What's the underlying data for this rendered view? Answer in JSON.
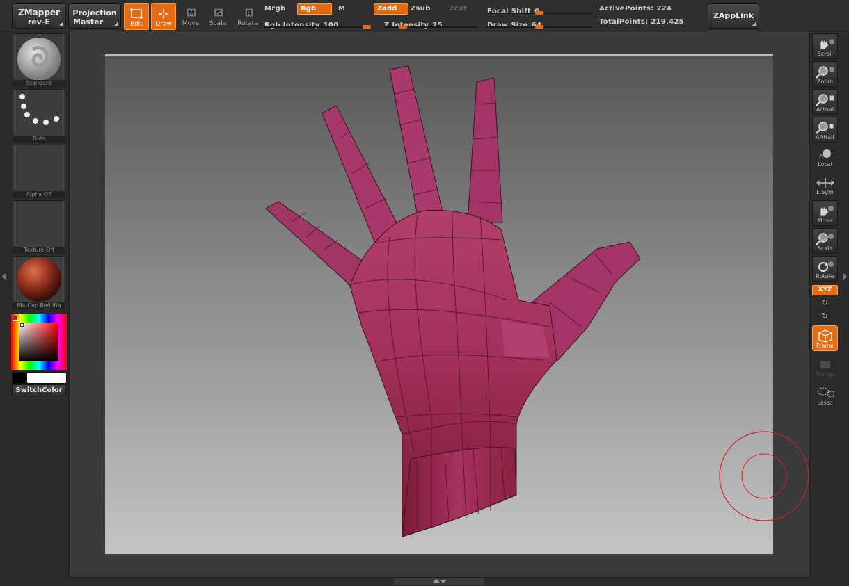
{
  "toolbar": {
    "zmapper": {
      "line1": "ZMapper",
      "line2": "rev-E"
    },
    "projection": {
      "line1": "Projection",
      "line2": "Master"
    },
    "tools": [
      {
        "label": "Edit",
        "icon": "edit-icon",
        "active": true
      },
      {
        "label": "Draw",
        "icon": "draw-icon",
        "active": true
      },
      {
        "label": "Move",
        "icon": "move-icon",
        "active": false
      },
      {
        "label": "Scale",
        "icon": "scale-icon",
        "active": false
      },
      {
        "label": "Rotate",
        "icon": "rotate-icon",
        "active": false
      }
    ],
    "mrgb": "Mrgb",
    "rgb": "Rgb",
    "m": "M",
    "rgb_intensity_label": "Rgb Intensity",
    "rgb_intensity_value": "100",
    "rgb_intensity_fraction": 1.0,
    "zadd": "Zadd",
    "zsub": "Zsub",
    "zcut": "Zcut",
    "z_intensity_label": "Z Intensity",
    "z_intensity_value": "25",
    "z_intensity_fraction": 0.25,
    "focal_shift_label": "Focal Shift",
    "focal_shift_value": "0",
    "focal_shift_fraction": 0.5,
    "draw_size_label": "Draw Size",
    "draw_size_value": "64",
    "draw_size_fraction": 0.5,
    "active_points_label": "ActivePoints:",
    "active_points_value": "224",
    "total_points_label": "TotalPoints:",
    "total_points_value": "219,425",
    "zapplink": "ZAppLink"
  },
  "left_panel": {
    "brush_label": "Standard",
    "stroke_label": "Dots",
    "alpha_label": "Alpha Off",
    "texture_label": "Texture Off",
    "material_label": "MatCap Red Wa",
    "switch_color": "SwitchColor",
    "colors": {
      "main": "#000000",
      "secondary": "#ffffff"
    }
  },
  "right_panel": {
    "buttons": [
      {
        "label": "Scroll",
        "icon": "scroll-icon"
      },
      {
        "label": "Zoom",
        "icon": "zoom-icon"
      },
      {
        "label": "Actual",
        "icon": "actual-icon"
      },
      {
        "label": "AAHalf",
        "icon": "aahalf-icon"
      },
      {
        "label": "Local",
        "icon": "local-icon"
      },
      {
        "label": "L.Sym",
        "icon": "lsym-icon"
      },
      {
        "label": "Move",
        "icon": "move-icon"
      },
      {
        "label": "Scale",
        "icon": "scale-icon"
      },
      {
        "label": "Rotate",
        "icon": "rotate-icon"
      }
    ],
    "xyz": "XYZ",
    "frame": "Frame",
    "transp": "Transp",
    "lasso": "Lasso"
  },
  "colors": {
    "accent": "#e46b0f",
    "hand": "#9c2a4f"
  }
}
